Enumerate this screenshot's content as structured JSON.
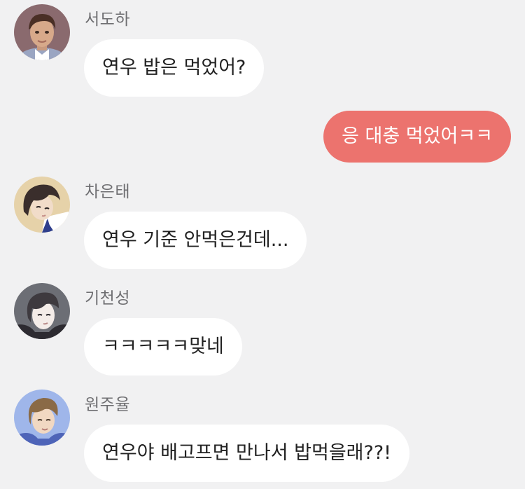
{
  "conversation": {
    "messages": [
      {
        "direction": "incoming",
        "sender": "서도하",
        "text": "연우 밥은 먹었어?",
        "avatar_icon": "avatar-icon"
      },
      {
        "direction": "outgoing",
        "text": "응 대충 먹었어ㅋㅋ"
      },
      {
        "direction": "incoming",
        "sender": "차은태",
        "text": "연우 기준 안먹은건데...",
        "avatar_icon": "avatar-icon"
      },
      {
        "direction": "incoming",
        "sender": "기천성",
        "text": "ㅋㅋㅋㅋㅋ맞네",
        "avatar_icon": "avatar-icon"
      },
      {
        "direction": "incoming",
        "sender": "원주율",
        "text": "연우야 배고프면 만나서 밥먹을래??!",
        "avatar_icon": "avatar-icon"
      }
    ]
  },
  "colors": {
    "background": "#f1f1f2",
    "incoming_bubble": "#ffffff",
    "outgoing_bubble": "#ec736e",
    "sender_name": "#6f6f72"
  }
}
